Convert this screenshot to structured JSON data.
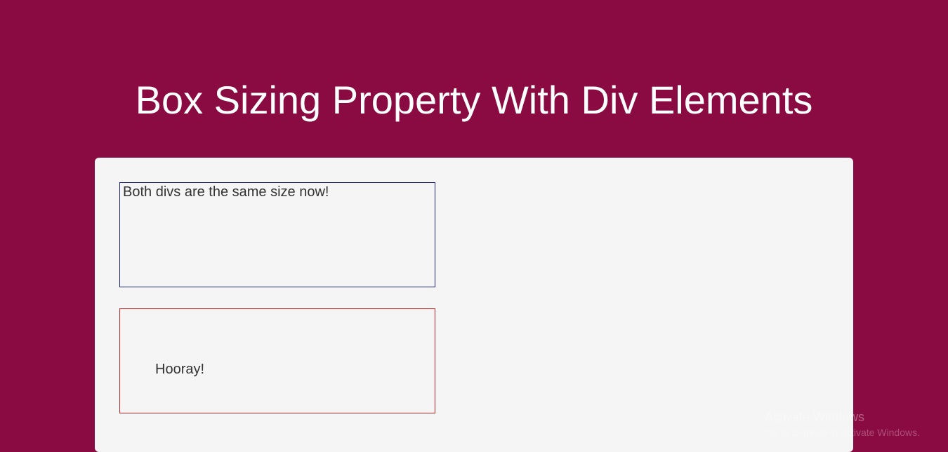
{
  "title": "Box Sizing Property With Div Elements",
  "boxes": {
    "first": {
      "text": "Both divs are the same size now!"
    },
    "second": {
      "text": "Hooray!"
    }
  },
  "watermark": {
    "line1": "Activate Windows",
    "line2": "Go to Settings to activate Windows."
  }
}
